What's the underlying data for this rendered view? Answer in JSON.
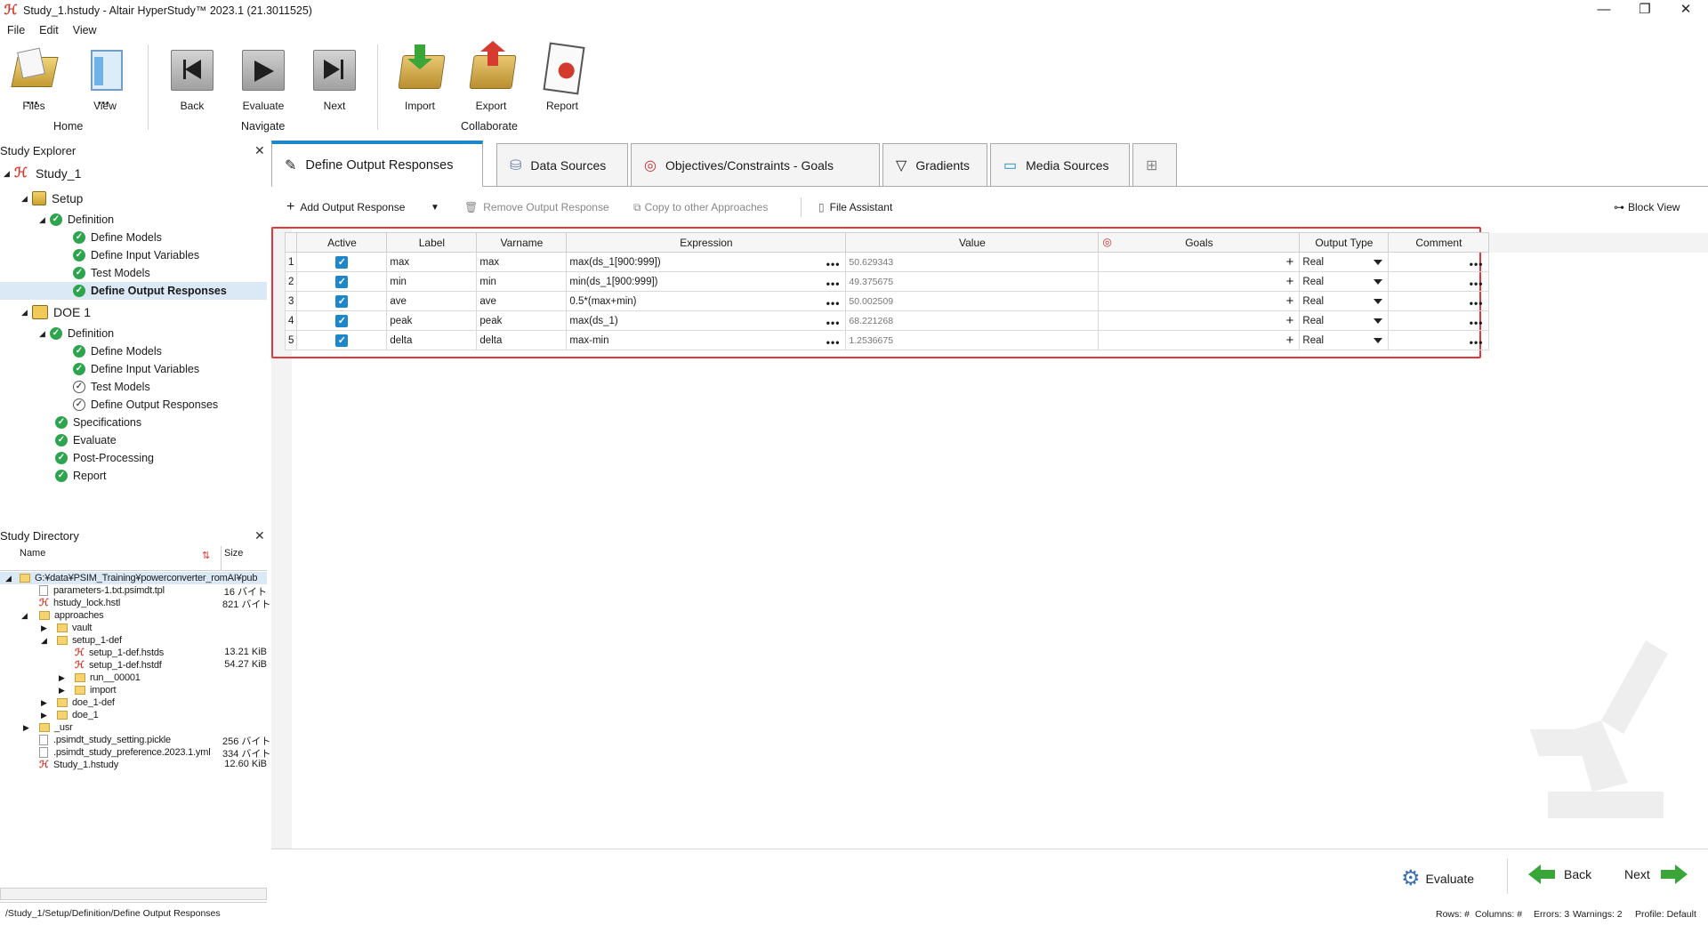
{
  "window": {
    "title": "Study_1.hstudy - Altair HyperStudy™ 2023.1 (21.3011525)",
    "minimize": "—",
    "restore": "❐",
    "close": "✕"
  },
  "menu": [
    "File",
    "Edit",
    "View"
  ],
  "ribbon": {
    "buttons": [
      {
        "label": "Files",
        "icon": "files-icon"
      },
      {
        "label": "View",
        "icon": "view-icon"
      },
      {
        "label": "Back",
        "icon": "back-icon"
      },
      {
        "label": "Evaluate",
        "icon": "evaluate-icon"
      },
      {
        "label": "Next",
        "icon": "next-icon"
      },
      {
        "label": "Import",
        "icon": "import-icon"
      },
      {
        "label": "Export",
        "icon": "export-icon"
      },
      {
        "label": "Report",
        "icon": "report-icon"
      }
    ],
    "groups": {
      "home": "Home",
      "navigate": "Navigate",
      "collaborate": "Collaborate"
    }
  },
  "study_explorer": {
    "title": "Study Explorer",
    "items": [
      {
        "label": "Study_1"
      },
      {
        "label": "Setup"
      },
      {
        "label": "Definition"
      },
      {
        "label": "Define Models"
      },
      {
        "label": "Define Input Variables"
      },
      {
        "label": "Test Models"
      },
      {
        "label": "Define Output Responses"
      },
      {
        "label": "DOE 1"
      },
      {
        "label": "Definition"
      },
      {
        "label": "Define Models"
      },
      {
        "label": "Define Input Variables"
      },
      {
        "label": "Test Models"
      },
      {
        "label": "Define Output Responses"
      },
      {
        "label": "Specifications"
      },
      {
        "label": "Evaluate"
      },
      {
        "label": "Post-Processing"
      },
      {
        "label": "Report"
      }
    ]
  },
  "study_directory": {
    "title": "Study Directory",
    "col_name": "Name",
    "col_size": "Size",
    "entries": [
      {
        "name": "G:¥data¥PSIM_Training¥powerconverter_romAI¥pub",
        "size": ""
      },
      {
        "name": "parameters-1.txt.psimdt.tpl",
        "size": "16 バイト"
      },
      {
        "name": "hstudy_lock.hstl",
        "size": "821 バイト"
      },
      {
        "name": "approaches",
        "size": ""
      },
      {
        "name": "vault",
        "size": ""
      },
      {
        "name": "setup_1-def",
        "size": ""
      },
      {
        "name": "setup_1-def.hstds",
        "size": "13.21 KiB"
      },
      {
        "name": "setup_1-def.hstdf",
        "size": "54.27 KiB"
      },
      {
        "name": "run__00001",
        "size": ""
      },
      {
        "name": "import",
        "size": ""
      },
      {
        "name": "doe_1-def",
        "size": ""
      },
      {
        "name": "doe_1",
        "size": ""
      },
      {
        "name": "_usr",
        "size": ""
      },
      {
        "name": ".psimdt_study_setting.pickle",
        "size": "256 バイト"
      },
      {
        "name": ".psimdt_study_preference.2023.1.yml",
        "size": "334 バイト"
      },
      {
        "name": "Study_1.hstudy",
        "size": "12.60 KiB"
      }
    ]
  },
  "tabs": [
    {
      "label": "Define Output Responses"
    },
    {
      "label": "Data Sources"
    },
    {
      "label": "Objectives/Constraints - Goals"
    },
    {
      "label": "Gradients"
    },
    {
      "label": "Media Sources"
    }
  ],
  "toolbar": {
    "add": "Add Output Response",
    "remove": "Remove Output Response",
    "copy": "Copy to other Approaches",
    "file_assistant": "File Assistant",
    "block_view": "Block View"
  },
  "table": {
    "headers": [
      "",
      "Active",
      "Label",
      "Varname",
      "Expression",
      "Value",
      "Goals",
      "Output Type",
      "Comment"
    ],
    "rows": [
      {
        "num": "1",
        "label": "max",
        "varname": "max",
        "expression": "max(ds_1[900:999])",
        "value": "50.629343",
        "type": "Real"
      },
      {
        "num": "2",
        "label": "min",
        "varname": "min",
        "expression": "min(ds_1[900:999])",
        "value": "49.375675",
        "type": "Real"
      },
      {
        "num": "3",
        "label": "ave",
        "varname": "ave",
        "expression": "0.5*(max+min)",
        "value": "50.002509",
        "type": "Real"
      },
      {
        "num": "4",
        "label": "peak",
        "varname": "peak",
        "expression": "max(ds_1)",
        "value": "68.221268",
        "type": "Real"
      },
      {
        "num": "5",
        "label": "delta",
        "varname": "delta",
        "expression": "max-min",
        "value": "1.2536675",
        "type": "Real"
      }
    ]
  },
  "bottom": {
    "evaluate": "Evaluate",
    "back": "Back",
    "next": "Next"
  },
  "status": {
    "path": "/Study_1/Setup/Definition/Define Output Responses",
    "rows": "Rows: #",
    "columns": "Columns: #",
    "errors": "Errors: 3",
    "warnings": "Warnings: 2",
    "profile": "Profile: Default"
  },
  "colors": {
    "accent": "#1e87c9",
    "highlight_border": "#e2383c",
    "success": "#2ea44f",
    "nav_arrow": "#3aa63a"
  }
}
